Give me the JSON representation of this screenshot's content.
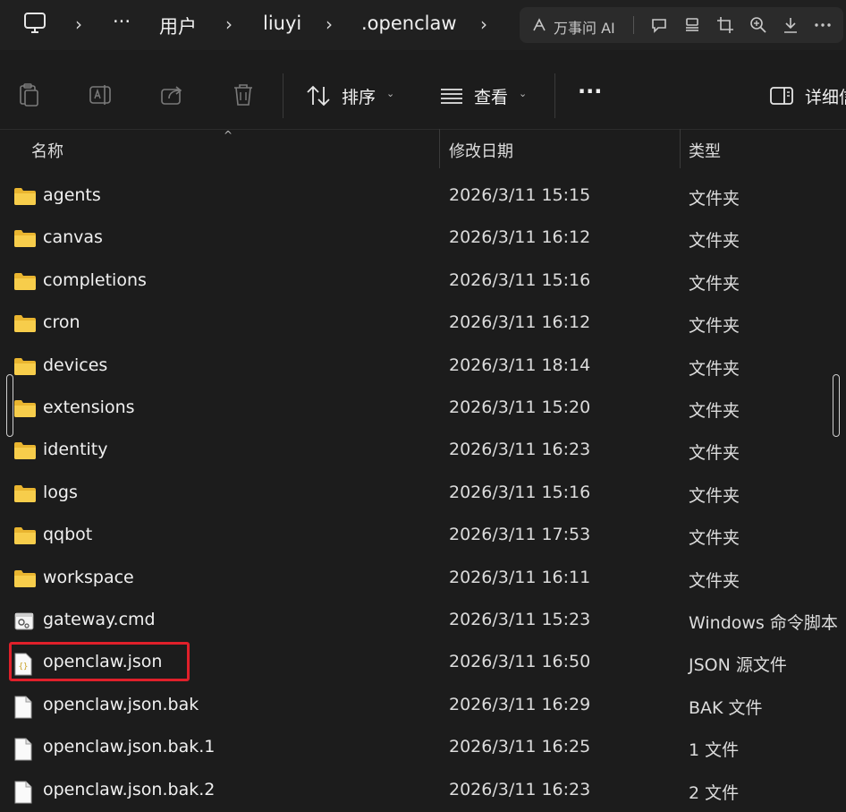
{
  "breadcrumb": {
    "items": [
      "用户",
      "liuyi",
      ".openclaw"
    ],
    "more": "···"
  },
  "ai_bar": {
    "label": "万事问 AI"
  },
  "toolbar": {
    "sort_label": "排序",
    "view_label": "查看",
    "more_label": "···",
    "details_label": "详细信"
  },
  "columns": {
    "name": "名称",
    "modified": "修改日期",
    "type": "类型"
  },
  "files": [
    {
      "name": "agents",
      "date": "2026/3/11 15:15",
      "type": "文件夹",
      "kind": "folder"
    },
    {
      "name": "canvas",
      "date": "2026/3/11 16:12",
      "type": "文件夹",
      "kind": "folder"
    },
    {
      "name": "completions",
      "date": "2026/3/11 15:16",
      "type": "文件夹",
      "kind": "folder"
    },
    {
      "name": "cron",
      "date": "2026/3/11 16:12",
      "type": "文件夹",
      "kind": "folder"
    },
    {
      "name": "devices",
      "date": "2026/3/11 18:14",
      "type": "文件夹",
      "kind": "folder"
    },
    {
      "name": "extensions",
      "date": "2026/3/11 15:20",
      "type": "文件夹",
      "kind": "folder"
    },
    {
      "name": "identity",
      "date": "2026/3/11 16:23",
      "type": "文件夹",
      "kind": "folder"
    },
    {
      "name": "logs",
      "date": "2026/3/11 15:16",
      "type": "文件夹",
      "kind": "folder"
    },
    {
      "name": "qqbot",
      "date": "2026/3/11 17:53",
      "type": "文件夹",
      "kind": "folder"
    },
    {
      "name": "workspace",
      "date": "2026/3/11 16:11",
      "type": "文件夹",
      "kind": "folder"
    },
    {
      "name": "gateway.cmd",
      "date": "2026/3/11 15:23",
      "type": "Windows 命令脚本",
      "kind": "cmd"
    },
    {
      "name": "openclaw.json",
      "date": "2026/3/11 16:50",
      "type": "JSON 源文件",
      "kind": "json"
    },
    {
      "name": "openclaw.json.bak",
      "date": "2026/3/11 16:29",
      "type": "BAK 文件",
      "kind": "file"
    },
    {
      "name": "openclaw.json.bak.1",
      "date": "2026/3/11 16:25",
      "type": "1 文件",
      "kind": "file"
    },
    {
      "name": "openclaw.json.bak.2",
      "date": "2026/3/11 16:23",
      "type": "2 文件",
      "kind": "file"
    }
  ],
  "colors": {
    "accent_highlight": "#e0202a",
    "folder": "#f4c542"
  }
}
